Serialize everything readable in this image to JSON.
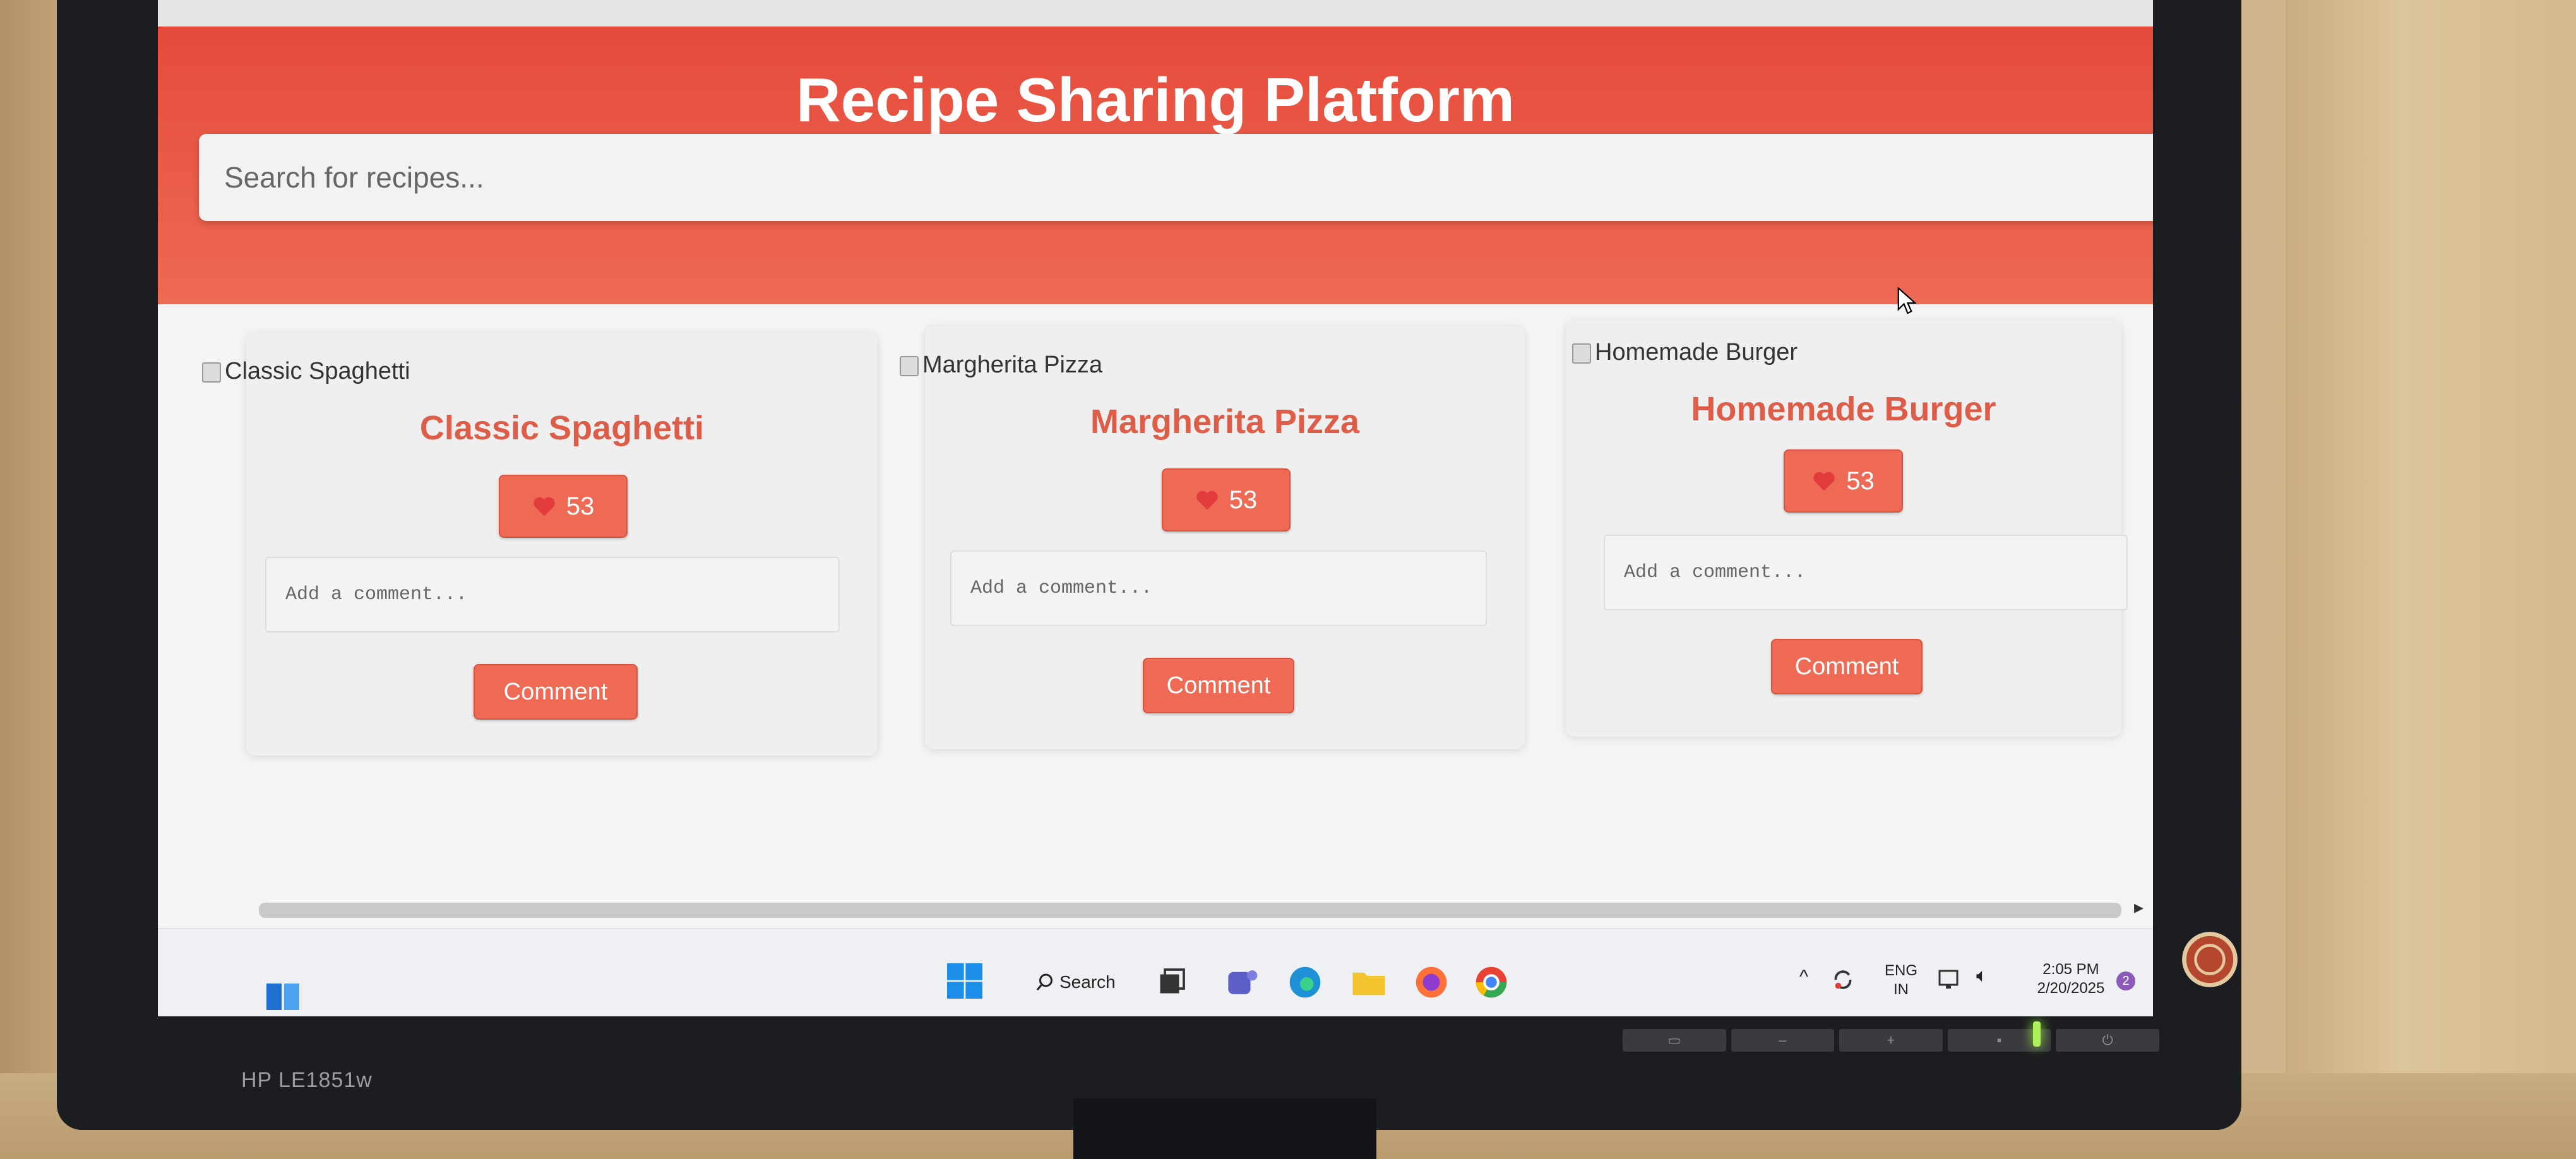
{
  "header": {
    "title": "Recipe Sharing Platform",
    "search_placeholder": "Search for recipes..."
  },
  "recipes": [
    {
      "alt": "Classic Spaghetti",
      "title": "Classic Spaghetti",
      "likes": "53",
      "comment_placeholder": "Add a comment...",
      "comment_label": "Comment"
    },
    {
      "alt": "Margherita Pizza",
      "title": "Margherita Pizza",
      "likes": "53",
      "comment_placeholder": "Add a comment...",
      "comment_label": "Comment"
    },
    {
      "alt": "Homemade Burger",
      "title": "Homemade Burger",
      "likes": "53",
      "comment_placeholder": "Add a comment...",
      "comment_label": "Comment"
    }
  ],
  "taskbar": {
    "search_label": "Search",
    "language_line1": "ENG",
    "language_line2": "IN",
    "time": "2:05 PM",
    "date": "2/20/2025",
    "notification_count": "2"
  },
  "monitor": {
    "brand": "HP LE1851w"
  },
  "colors": {
    "header": "#e64a3a",
    "accent": "#ee6a55",
    "title_text": "#de5d48"
  }
}
